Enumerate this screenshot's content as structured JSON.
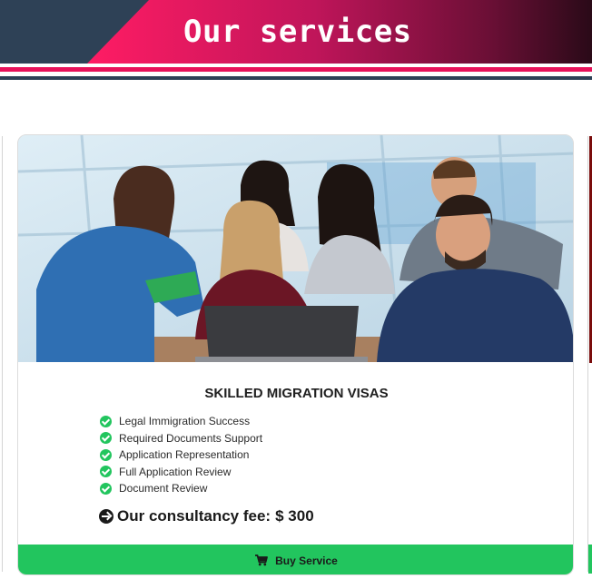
{
  "header": {
    "title": "Our services"
  },
  "service": {
    "title": "SKILLED MIGRATION VISAS",
    "features": [
      "Legal Immigration Success",
      "Required Documents Support",
      "Application Representation",
      "Full Application Review",
      "Document Review"
    ],
    "fee_label": "Our consultancy fee:",
    "fee_amount": "$ 300",
    "buy_label": "Buy Service"
  },
  "colors": {
    "banner_navy": "#2e4156",
    "banner_pink": "#ff1c64",
    "stripe_pink": "#e8125a",
    "accent_green": "#22c55e"
  },
  "icons": {
    "feature": "check-circle-icon",
    "fee": "arrow-circle-right-icon",
    "buy": "cart-icon"
  }
}
